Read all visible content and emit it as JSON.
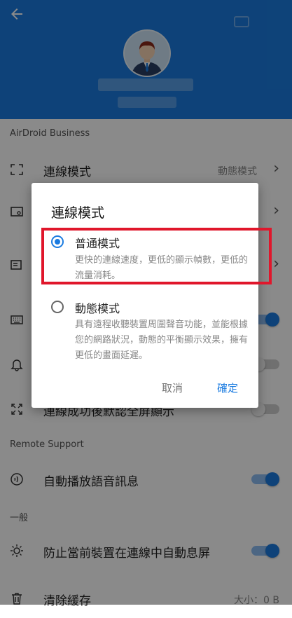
{
  "settings": {
    "section_business": "AirDroid Business",
    "section_remote": "Remote Support",
    "section_general": "一般",
    "rows": {
      "connection_mode": {
        "label": "連線模式",
        "value": "動態模式"
      },
      "auto_fullscreen": {
        "label": "連線成功後默認全屏顯示"
      },
      "auto_voice": {
        "label": "自動播放語音訊息"
      },
      "prevent_sleep": {
        "label": "防止當前裝置在連線中自動息屏"
      },
      "clear_cache": {
        "label": "清除緩存",
        "value": "大小：0 B"
      }
    }
  },
  "dialog": {
    "title": "連線模式",
    "options": [
      {
        "title": "普通模式",
        "description": "更快的連線速度，更低的顯示幀數，更低的流量消耗。",
        "selected": true
      },
      {
        "title": "動態模式",
        "description": "具有遠程收聽裝置周圍聲音功能，並能根據您的網路狀況，動態的平衡顯示效果，擁有更低的畫面延遲。",
        "selected": false
      }
    ],
    "cancel_label": "取消",
    "ok_label": "確定"
  },
  "colors": {
    "primary": "#1a7be0",
    "highlight_border": "#e0162b"
  }
}
